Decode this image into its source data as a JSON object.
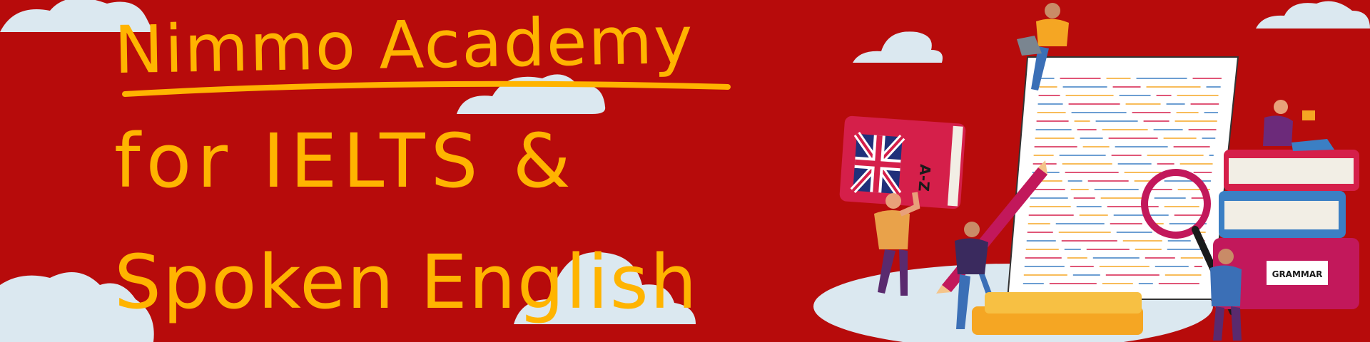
{
  "headline": {
    "line1": "Nimmo Academy",
    "line2": "for IELTS &",
    "line3": "Spoken English"
  },
  "illustration": {
    "dictionary_label": "A-Z",
    "book_label": "GRAMMAR"
  },
  "colors": {
    "background": "#b70b0b",
    "headline": "#ffb400",
    "cloud": "#dbe8f0"
  },
  "icons": [
    "cloud-icon",
    "dictionary-icon",
    "union-flag-icon",
    "pencil-icon",
    "magnifier-icon",
    "notebook-icon",
    "book-stack-icon",
    "person-icon",
    "laptop-icon"
  ]
}
